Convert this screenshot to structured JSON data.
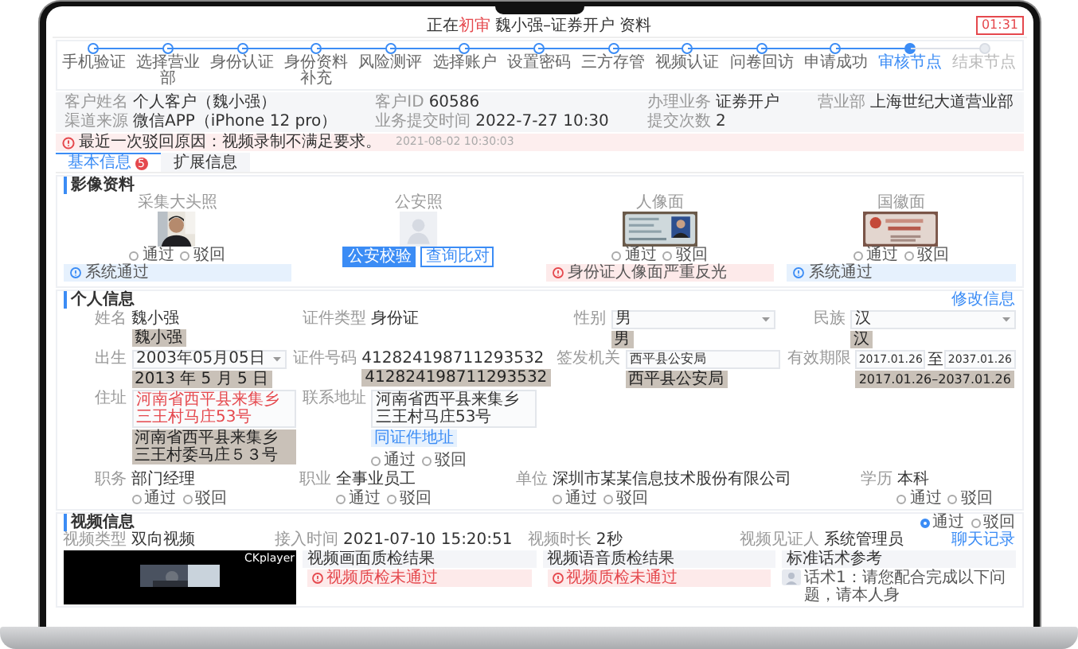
{
  "header": {
    "prefix": "正在",
    "stage": "初审",
    "title": "魏小强–证券开户",
    "suffix": "资料",
    "timer": "01:31"
  },
  "steps": [
    {
      "label": "手机验证",
      "done": true,
      "current": false
    },
    {
      "label": "选择营业部",
      "done": true,
      "current": false
    },
    {
      "label": "身份认证",
      "done": true,
      "current": false
    },
    {
      "label": "身份资料补充",
      "done": true,
      "current": false
    },
    {
      "label": "风险测评",
      "done": true,
      "current": false
    },
    {
      "label": "选择账户",
      "done": true,
      "current": false
    },
    {
      "label": "设置密码",
      "done": true,
      "current": false
    },
    {
      "label": "三方存管",
      "done": true,
      "current": false
    },
    {
      "label": "视频认证",
      "done": true,
      "current": false
    },
    {
      "label": "问卷回访",
      "done": true,
      "current": false
    },
    {
      "label": "申请成功",
      "done": true,
      "current": false
    },
    {
      "label": "审核节点",
      "done": false,
      "current": true
    },
    {
      "label": "结束节点",
      "done": false,
      "current": false
    }
  ],
  "summary": [
    {
      "label": "客户姓名",
      "value": "个人客户（魏小强）"
    },
    {
      "label": "客户ID",
      "value": "60586"
    },
    {
      "label": "办理业务",
      "value": "证券开户"
    },
    {
      "label": "营业部",
      "value": "上海世纪大道营业部"
    },
    {
      "label": "渠道来源",
      "value": "微信APP（iPhone 12 pro）"
    },
    {
      "label": "业务提交时间",
      "value": "2022-7-27 10:30"
    },
    {
      "label": "提交次数",
      "value": "2"
    }
  ],
  "alert": {
    "text": "最近一次驳回原因：视频录制不满足要求。",
    "time": "2021-08-02 10:30:03"
  },
  "tabs": [
    {
      "label": "基本信息",
      "badge": "5",
      "selected": true
    },
    {
      "label": "扩展信息",
      "selected": false
    }
  ],
  "images": {
    "title": "影像资料",
    "items": [
      {
        "label": "采集大头照",
        "kind": "portrait",
        "options": [
          {
            "label": "通过",
            "selected": false
          },
          {
            "label": "驳回",
            "selected": false
          }
        ],
        "note": {
          "text": "系统通过",
          "error": false
        }
      },
      {
        "label": "公安照",
        "kind": "placeholder",
        "buttons": [
          {
            "label": "公安校验",
            "primary": true
          },
          {
            "label": "查询比对",
            "primary": false
          }
        ]
      },
      {
        "label": "人像面",
        "kind": "id_front",
        "options": [
          {
            "label": "通过",
            "selected": false
          },
          {
            "label": "驳回",
            "selected": false
          }
        ],
        "note": {
          "text": "身份证人像面严重反光",
          "error": true
        }
      },
      {
        "label": "国徽面",
        "kind": "id_back",
        "options": [
          {
            "label": "通过",
            "selected": false
          },
          {
            "label": "驳回",
            "selected": false
          }
        ],
        "note": {
          "text": "系统通过",
          "error": false
        }
      }
    ]
  },
  "personal": {
    "title": "个人信息",
    "action": "修改信息",
    "rows": [
      [
        {
          "label": "姓名",
          "kind": "text",
          "value": "魏小强",
          "ocr": "魏小强"
        },
        {
          "label": "证件类型",
          "kind": "text",
          "value": "身份证"
        },
        {
          "label": "性别",
          "kind": "select",
          "value": "男",
          "ocr": "男"
        },
        {
          "label": "民族",
          "kind": "select",
          "value": "汉",
          "ocr": "汉"
        }
      ],
      [
        {
          "label": "出生",
          "kind": "select",
          "value": "2003年05月05日",
          "ocr": "2013 年 5 月 5 日"
        },
        {
          "label": "证件号码",
          "kind": "text",
          "value": "412824198711293532",
          "ocr": "412824198711293532"
        },
        {
          "label": "签发机关",
          "kind": "input",
          "value": "西平县公安局",
          "ocr": "西平县公安局"
        },
        {
          "label": "有效期限",
          "kind": "daterange",
          "values": [
            "2017.01.26",
            "2037.01.26"
          ],
          "separator": "至",
          "ocr": "2017.01.26–2037.01.26"
        }
      ],
      [
        {
          "label": "住址",
          "kind": "textarea",
          "value": "河南省西平县来集乡三王村马庄53号",
          "warning": true,
          "ocr": "河南省西平县来集乡三王村委马庄５３号"
        },
        {
          "label": "联系地址",
          "kind": "textarea",
          "value": "河南省西平县来集乡三王村马庄53号",
          "warning": false,
          "tag": "同证件地址",
          "options": [
            {
              "label": "通过",
              "selected": false
            },
            {
              "label": "驳回",
              "selected": false
            }
          ]
        }
      ],
      [
        {
          "label": "职务",
          "kind": "text",
          "value": "部门经理",
          "options": [
            {
              "label": "通过",
              "selected": false
            },
            {
              "label": "驳回",
              "selected": false
            }
          ]
        },
        {
          "label": "职业",
          "kind": "text",
          "value": "全事业员工",
          "options": [
            {
              "label": "通过",
              "selected": false
            },
            {
              "label": "驳回",
              "selected": false
            }
          ]
        },
        {
          "label": "单位",
          "kind": "text",
          "value": "深圳市某某信息技术股份有限公司",
          "options": [
            {
              "label": "通过",
              "selected": false
            },
            {
              "label": "驳回",
              "selected": false
            }
          ]
        },
        {
          "label": "学历",
          "kind": "text",
          "value": "本科",
          "options": [
            {
              "label": "通过",
              "selected": false
            },
            {
              "label": "驳回",
              "selected": false
            }
          ]
        }
      ]
    ]
  },
  "video": {
    "title": "视频信息",
    "options": [
      {
        "label": "通过",
        "selected": true
      },
      {
        "label": "驳回",
        "selected": false
      }
    ],
    "meta": [
      {
        "label": "视频类型",
        "value": "双向视频"
      },
      {
        "label": "接入时间",
        "value": "2021-07-10 15:20:51"
      },
      {
        "label": "视频时长",
        "value": "2秒"
      },
      {
        "label": "视频见证人",
        "value": "系统管理员"
      }
    ],
    "link": "聊天记录",
    "player": "CKplayer",
    "checks": [
      {
        "title": "视频画面质检结果",
        "result": "视频质检未通过"
      },
      {
        "title": "视频语音质检结果",
        "result": "视频质检未通过"
      }
    ],
    "script": {
      "title": "标准话术参考",
      "text": "话术1：请您配合完成以下问题，请本人身"
    }
  }
}
